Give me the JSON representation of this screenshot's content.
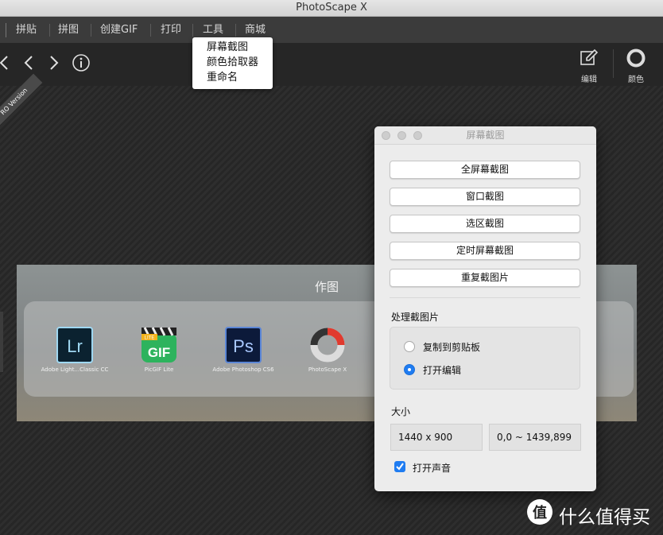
{
  "window": {
    "title": "PhotoScape X"
  },
  "menu": {
    "tabs": [
      {
        "label": "拼贴"
      },
      {
        "label": "拼图"
      },
      {
        "label": "创建GIF"
      },
      {
        "label": "打印"
      },
      {
        "label": "工具"
      },
      {
        "label": "商城"
      }
    ]
  },
  "dropdown": {
    "items": [
      "屏幕截图",
      "颜色拾取器",
      "重命名"
    ]
  },
  "toolbar": {
    "edit_label": "编辑",
    "color_label": "颜色",
    "icons": [
      "chevron-left-icon",
      "chevron-left-icon",
      "chevron-right-icon",
      "info-icon",
      "edit-icon",
      "color-ring-icon"
    ]
  },
  "ribbon": {
    "text": "RO Version"
  },
  "panel": {
    "title": "作图",
    "apps": [
      {
        "name": "Adobe Light...Classic CC",
        "icon_text": "Lr"
      },
      {
        "name": "PicGIF Lite",
        "icon_text": "GIF",
        "badge": "LITE"
      },
      {
        "name": "Adobe Photoshop CS6",
        "icon_text": "Ps"
      },
      {
        "name": "PhotoScape X",
        "icon_text": ""
      }
    ]
  },
  "dialog": {
    "title": "屏幕截图",
    "buttons": [
      "全屏幕截图",
      "窗口截图",
      "选区截图",
      "定时屏幕截图",
      "重复截图片"
    ],
    "processing_label": "处理截图片",
    "options": [
      {
        "label": "复制到剪贴板",
        "selected": false
      },
      {
        "label": "打开编辑",
        "selected": true
      }
    ],
    "size_label": "大小",
    "size_value": "1440 x 900",
    "range_value": "0,0 ~ 1439,899",
    "sound": {
      "label": "打开声音",
      "checked": true
    }
  },
  "watermark": {
    "text": "什么值得买"
  },
  "colors": {
    "accent": "#1f7cf1",
    "toolbar_bg": "#262626",
    "menubar_bg": "#3b3b3b",
    "dialog_bg": "#ececec"
  }
}
